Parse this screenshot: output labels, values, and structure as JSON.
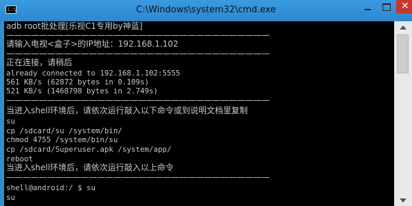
{
  "window": {
    "title": "C:\\Windows\\system32\\cmd.exe",
    "icon_text": "C:\\",
    "close_symbol": "✕"
  },
  "console": {
    "lines": [
      "adb root批处理[乐视C1专用by神蓝]",
      "————————————————————————————————",
      "请输入电视<盒子>的IP地址：192.168.1.102",
      "————————————————————————————————",
      "正在连接，请稍后",
      "already connected to 192.168.1.102:5555",
      "561 KB/s (62872 bytes in 0.109s)",
      "521 KB/s (1468798 bytes in 2.749s)",
      "————————————————————————————————",
      "当进入shell环境后，请依次运行敲入以下命令或到说明文档里复制",
      "su",
      "cp /sdcard/su /system/bin/",
      "chmod 4755 /system/bin/su",
      "cp /sdcard/Superuser.apk /system/app/",
      "reboot",
      "当进入shell环境后，请依次运行敲入以上命令",
      "————————————————————————————————",
      "shell@android:/ $ su",
      "su"
    ]
  },
  "colors": {
    "window_frame": "#2f8fd4",
    "console_bg": "#000000",
    "console_text": "#c8c8c8",
    "close_button": "#c7372f"
  },
  "icons": [
    "cmd-app-icon",
    "minimize-icon",
    "maximize-icon",
    "close-icon",
    "scroll-up-arrow-icon",
    "scroll-down-arrow-icon"
  ]
}
